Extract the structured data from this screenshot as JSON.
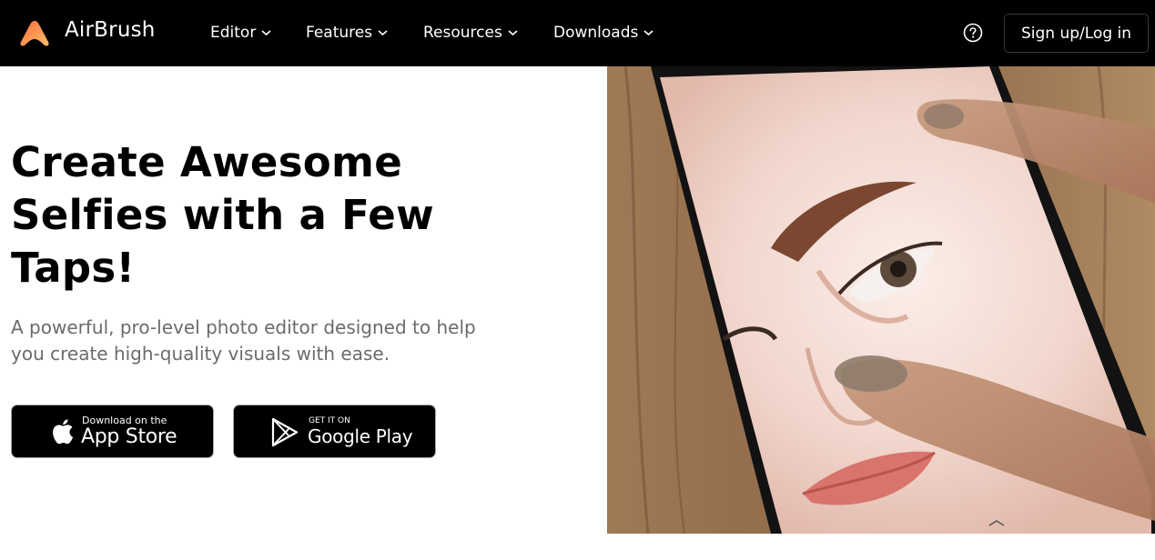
{
  "header": {
    "brand": "AirBrush",
    "menu": [
      {
        "label": "Editor"
      },
      {
        "label": "Features"
      },
      {
        "label": "Resources"
      },
      {
        "label": "Downloads"
      }
    ],
    "help_icon": "help-circle-icon",
    "signup_label": "Sign up/Log in"
  },
  "hero": {
    "headline_lines": [
      "Create Awesome",
      "Selfies with a Few",
      "Taps!"
    ],
    "subhead_lines": [
      "A powerful, pro-level photo editor designed to help",
      "you create high-quality visuals with ease."
    ],
    "app_store": {
      "small": "Download on the",
      "big": "App Store",
      "icon": "apple-icon"
    },
    "google_play": {
      "small": "GET IT ON",
      "big": "Google Play",
      "icon": "google-play-icon"
    }
  },
  "colors": {
    "nav_bg": "#000000",
    "logo_gradient": [
      "#ff7a3d",
      "#ffb35c"
    ],
    "subhead_text": "#6b6b6b"
  }
}
